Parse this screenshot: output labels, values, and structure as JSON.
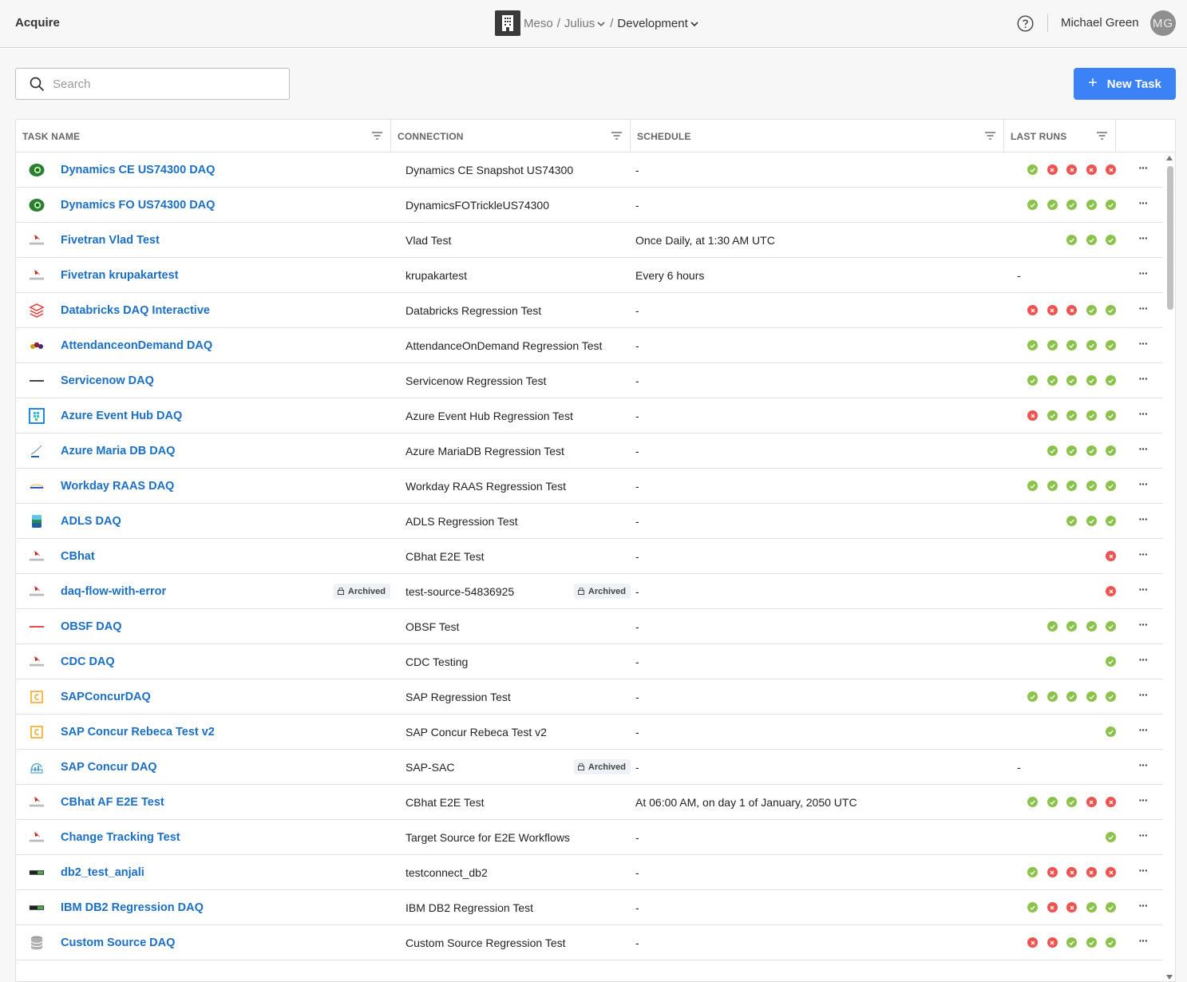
{
  "header": {
    "app_title": "Acquire",
    "org": "Meso",
    "workspace": "Julius",
    "environment": "Development",
    "separator": "/",
    "user_name": "Michael Green",
    "user_initials": "MG"
  },
  "toolbar": {
    "search_placeholder": "Search",
    "new_task_label": "New Task"
  },
  "columns": {
    "task_name": "TASK NAME",
    "connection": "CONNECTION",
    "schedule": "SCHEDULE",
    "last_runs": "LAST RUNS"
  },
  "archived_label": "Archived",
  "menu_glyph": "···",
  "colors": {
    "accent": "#3b82f6",
    "link": "#1b6fc5",
    "success": "#8bc34a",
    "failure": "#ef5350"
  },
  "tasks": [
    {
      "icon": "dynamics-icon",
      "name": "Dynamics CE US74300 DAQ",
      "connection": "Dynamics CE Snapshot US74300",
      "schedule": "-",
      "runs": [
        "ok",
        "err",
        "err",
        "err",
        "err"
      ]
    },
    {
      "icon": "dynamics-icon",
      "name": "Dynamics FO US74300 DAQ",
      "connection": "DynamicsFOTrickleUS74300",
      "schedule": "-",
      "runs": [
        "ok",
        "ok",
        "ok",
        "ok",
        "ok"
      ]
    },
    {
      "icon": "sql-server-icon",
      "name": "Fivetran Vlad Test",
      "connection": "Vlad Test",
      "schedule": "Once Daily, at 1:30 AM UTC",
      "runs": [
        "ok",
        "ok",
        "ok"
      ]
    },
    {
      "icon": "sql-server-icon",
      "name": "Fivetran krupakartest",
      "connection": "krupakartest",
      "schedule": "Every 6 hours",
      "runs": [],
      "runs_text": "-"
    },
    {
      "icon": "databricks-icon",
      "name": "Databricks DAQ Interactive",
      "connection": "Databricks Regression Test",
      "schedule": "-",
      "runs": [
        "err",
        "err",
        "err",
        "ok",
        "ok"
      ]
    },
    {
      "icon": "attendance-icon",
      "name": "AttendanceonDemand DAQ",
      "connection": "AttendanceOnDemand Regression Test",
      "schedule": "-",
      "runs": [
        "ok",
        "ok",
        "ok",
        "ok",
        "ok"
      ]
    },
    {
      "icon": "servicenow-icon",
      "name": "Servicenow DAQ",
      "connection": "Servicenow Regression Test",
      "schedule": "-",
      "runs": [
        "ok",
        "ok",
        "ok",
        "ok",
        "ok"
      ]
    },
    {
      "icon": "event-hub-icon",
      "name": "Azure Event Hub DAQ",
      "connection": "Azure Event Hub Regression Test",
      "schedule": "-",
      "runs": [
        "err",
        "ok",
        "ok",
        "ok",
        "ok"
      ]
    },
    {
      "icon": "mariadb-icon",
      "name": "Azure Maria DB DAQ",
      "connection": "Azure MariaDB Regression Test",
      "schedule": "-",
      "runs": [
        "ok",
        "ok",
        "ok",
        "ok"
      ]
    },
    {
      "icon": "workday-icon",
      "name": "Workday RAAS DAQ",
      "connection": "Workday RAAS Regression Test",
      "schedule": "-",
      "runs": [
        "ok",
        "ok",
        "ok",
        "ok",
        "ok"
      ]
    },
    {
      "icon": "adls-icon",
      "name": "ADLS DAQ",
      "connection": "ADLS Regression Test",
      "schedule": "-",
      "runs": [
        "ok",
        "ok",
        "ok"
      ]
    },
    {
      "icon": "sql-server-icon",
      "name": "CBhat",
      "connection": "CBhat E2E Test",
      "schedule": "-",
      "runs": [
        "err"
      ]
    },
    {
      "icon": "sql-server-icon",
      "name": "daq-flow-with-error",
      "name_archived": true,
      "connection": "test-source-54836925",
      "conn_archived": true,
      "schedule": "-",
      "runs": [
        "err"
      ]
    },
    {
      "icon": "oracle-icon",
      "name": "OBSF DAQ",
      "connection": "OBSF Test",
      "schedule": "-",
      "runs": [
        "ok",
        "ok",
        "ok",
        "ok"
      ]
    },
    {
      "icon": "sql-server-icon",
      "name": "CDC DAQ",
      "connection": "CDC Testing",
      "schedule": "-",
      "runs": [
        "ok"
      ]
    },
    {
      "icon": "sap-concur-icon",
      "name": "SAPConcurDAQ",
      "connection": "SAP Regression Test",
      "schedule": "-",
      "runs": [
        "ok",
        "ok",
        "ok",
        "ok",
        "ok"
      ]
    },
    {
      "icon": "sap-concur-icon",
      "name": "SAP Concur Rebeca Test v2",
      "connection": "SAP Concur Rebeca Test v2",
      "schedule": "-",
      "runs": [
        "ok"
      ]
    },
    {
      "icon": "sap-sac-icon",
      "name": "SAP Concur DAQ",
      "connection": "SAP-SAC",
      "conn_archived": true,
      "schedule": "-",
      "runs": [],
      "runs_text": "-"
    },
    {
      "icon": "sql-server-icon",
      "name": "CBhat AF E2E Test",
      "connection": "CBhat E2E Test",
      "schedule": "At 06:00 AM, on day 1 of January, 2050 UTC",
      "runs": [
        "ok",
        "ok",
        "ok",
        "err",
        "err"
      ]
    },
    {
      "icon": "sql-server-icon",
      "name": "Change Tracking Test",
      "connection": "Target Source for E2E Workflows",
      "schedule": "-",
      "runs": [
        "ok"
      ]
    },
    {
      "icon": "db2-icon",
      "name": "db2_test_anjali",
      "connection": "testconnect_db2",
      "schedule": "-",
      "runs": [
        "ok",
        "err",
        "err",
        "err",
        "err"
      ]
    },
    {
      "icon": "db2-icon",
      "name": "IBM DB2 Regression DAQ",
      "connection": "IBM DB2 Regression Test",
      "schedule": "-",
      "runs": [
        "ok",
        "err",
        "err",
        "ok",
        "ok"
      ]
    },
    {
      "icon": "database-icon",
      "name": "Custom Source DAQ",
      "connection": "Custom Source Regression Test",
      "schedule": "-",
      "runs": [
        "err",
        "err",
        "ok",
        "ok",
        "ok"
      ]
    }
  ]
}
